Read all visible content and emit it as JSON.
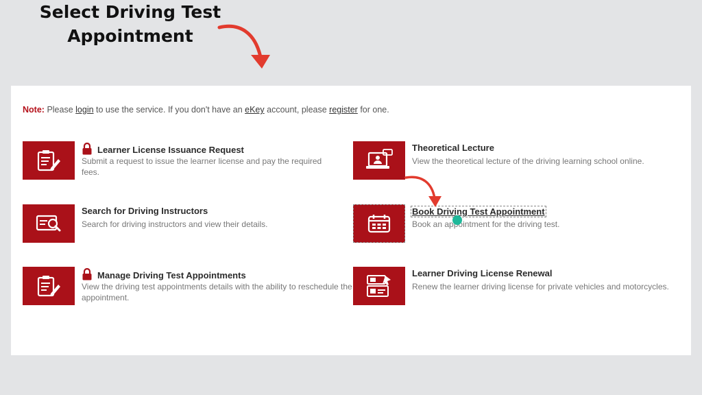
{
  "headline": {
    "line1": "Select Driving Test",
    "line2": "Appointment"
  },
  "note": {
    "label": "Note:",
    "t1": "Please ",
    "login": "login",
    "t2": " to use the service. If you don't have an ",
    "ekey": "eKey",
    "t3": " account, please ",
    "register": "register",
    "t4": " for one."
  },
  "services": [
    {
      "title": "Learner License Issuance Request",
      "desc": "Submit a request to issue the learner license and pay the required fees.",
      "locked": true,
      "icon": "clipboard-edit-icon"
    },
    {
      "title": "Theoretical Lecture",
      "desc": "View the theoretical lecture of the driving learning school online.",
      "locked": false,
      "icon": "online-lecture-icon"
    },
    {
      "title": "Search for Driving Instructors",
      "desc": "Search for driving instructors and view their details.",
      "locked": false,
      "icon": "id-card-search-icon"
    },
    {
      "title": "Book Driving Test Appointment",
      "desc": "Book an appointment for the driving test.",
      "locked": false,
      "icon": "calendar-icon"
    },
    {
      "title": "Manage Driving Test Appointments",
      "desc": "View the driving test appointments details with the ability to reschedule the appointment.",
      "locked": true,
      "icon": "clipboard-edit-icon"
    },
    {
      "title": "Learner Driving License Renewal",
      "desc": "Renew the learner driving license for private vehicles and motorcycles.",
      "locked": false,
      "icon": "license-card-icon"
    }
  ],
  "colors": {
    "brand_red": "#aa1119",
    "annotation_red": "#e23b2e",
    "cursor": "#1fb89a",
    "background": "#e3e4e6"
  }
}
